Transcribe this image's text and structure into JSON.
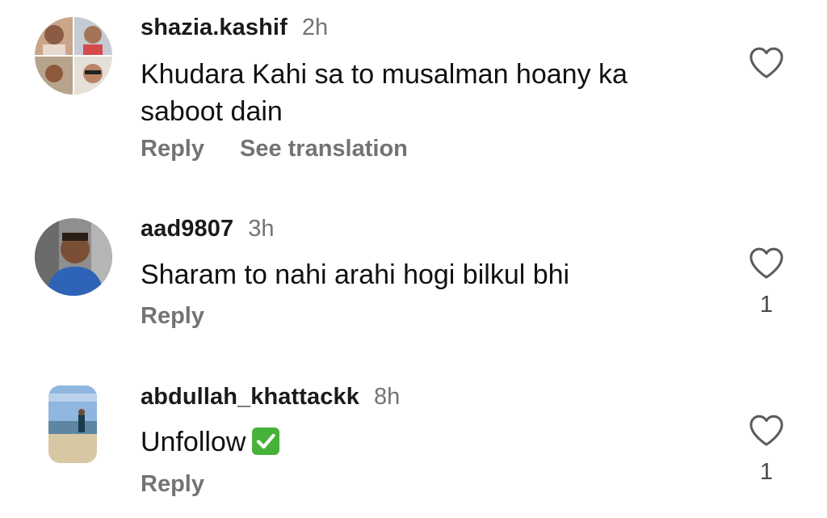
{
  "comments": [
    {
      "username": "shazia.kashif",
      "time": "2h",
      "text": "Khudara Kahi sa to musalman hoany ka saboot dain",
      "actions": [
        "Reply",
        "See translation"
      ],
      "likes": ""
    },
    {
      "username": "aad9807",
      "time": "3h",
      "text": "Sharam to nahi arahi hogi bilkul bhi",
      "actions": [
        "Reply"
      ],
      "likes": "1"
    },
    {
      "username": "abdullah_khattackk",
      "time": "8h",
      "text": "Unfollow",
      "emoji": "check-mark-button-emoji",
      "actions": [
        "Reply"
      ],
      "likes": "1"
    }
  ],
  "icons": {
    "like": "heart-outline-icon"
  },
  "colors": {
    "username": "#1a1a1a",
    "secondary": "#737373",
    "check_green": "#46b23a"
  }
}
